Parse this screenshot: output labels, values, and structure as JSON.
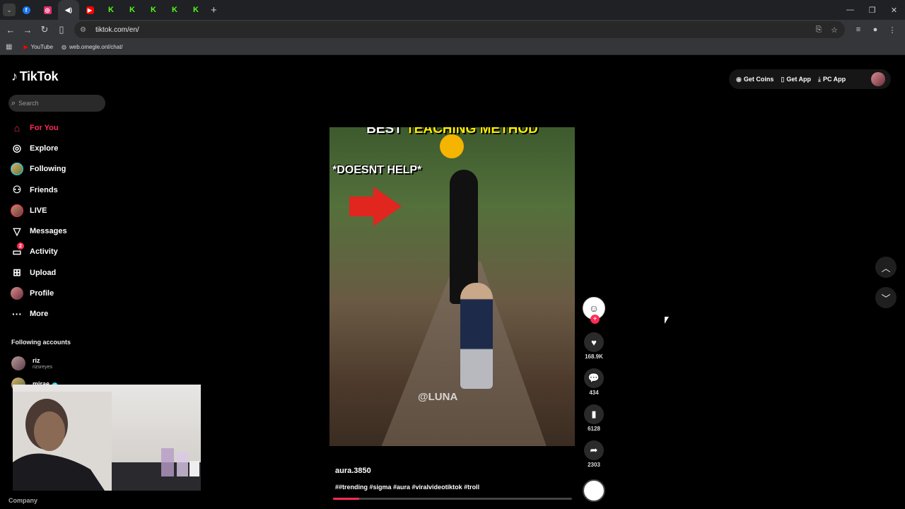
{
  "browser": {
    "tabs": [
      {
        "icon": "chevron-down-icon"
      },
      {
        "icon": "facebook-icon",
        "color": "#1877f2",
        "glyph": "f"
      },
      {
        "icon": "instagram-icon",
        "color": "#e1306c",
        "glyph": "◎"
      },
      {
        "icon": "speaker-icon",
        "color": "#ffffff",
        "glyph": "🔊"
      },
      {
        "icon": "youtube-icon",
        "color": "#ff0000",
        "glyph": "▶"
      },
      {
        "icon": "kick-icon",
        "color": "#53fc18",
        "glyph": "K"
      },
      {
        "icon": "kick-icon",
        "color": "#53fc18",
        "glyph": "K"
      },
      {
        "icon": "kick-icon",
        "color": "#53fc18",
        "glyph": "K"
      },
      {
        "icon": "kick-icon",
        "color": "#53fc18",
        "glyph": "K"
      },
      {
        "icon": "kick-icon",
        "color": "#53fc18",
        "glyph": "K"
      }
    ],
    "url": "tiktok.com/en/",
    "bookmarks": [
      {
        "label": "YouTube",
        "icon": "youtube-icon"
      },
      {
        "label": "web.omegle.onl/chat/",
        "icon": "globe-icon"
      }
    ]
  },
  "tiktok": {
    "logo": "TikTok",
    "search_placeholder": "Search",
    "nav": [
      {
        "label": "For You",
        "icon": "home-icon",
        "active": true
      },
      {
        "label": "Explore",
        "icon": "compass-icon"
      },
      {
        "label": "Following",
        "icon": "following-avatar-icon"
      },
      {
        "label": "Friends",
        "icon": "friends-icon"
      },
      {
        "label": "LIVE",
        "icon": "live-avatar-icon"
      },
      {
        "label": "Messages",
        "icon": "messages-icon"
      },
      {
        "label": "Activity",
        "icon": "activity-icon",
        "badge": "2"
      },
      {
        "label": "Upload",
        "icon": "upload-icon"
      },
      {
        "label": "Profile",
        "icon": "profile-avatar-icon"
      },
      {
        "label": "More",
        "icon": "more-icon"
      }
    ],
    "following_accounts_title": "Following accounts",
    "following_accounts": [
      {
        "name": "riz",
        "handle": "rizsreyes"
      },
      {
        "name": "mirae",
        "verified": true
      }
    ],
    "footer_company": "Company",
    "top_actions": [
      {
        "label": "Get Coins",
        "icon": "coin-icon"
      },
      {
        "label": "Get App",
        "icon": "phone-icon"
      },
      {
        "label": "PC App",
        "icon": "download-icon"
      }
    ],
    "video": {
      "title_part1": "BEST",
      "title_highlight": "TEACHING METHOD",
      "subtitle": "*DOESNT HELP*",
      "watermark": "@LUNA",
      "author": "aura.3850",
      "caption": "##trending #sigma #aura #viralvideotiktok #troll",
      "progress_fraction": 0.11
    },
    "actions": {
      "likes": "168.9K",
      "comments": "434",
      "saves": "6128",
      "shares": "2303"
    }
  },
  "colors": {
    "accent": "#fe2c55",
    "background": "#000000"
  }
}
